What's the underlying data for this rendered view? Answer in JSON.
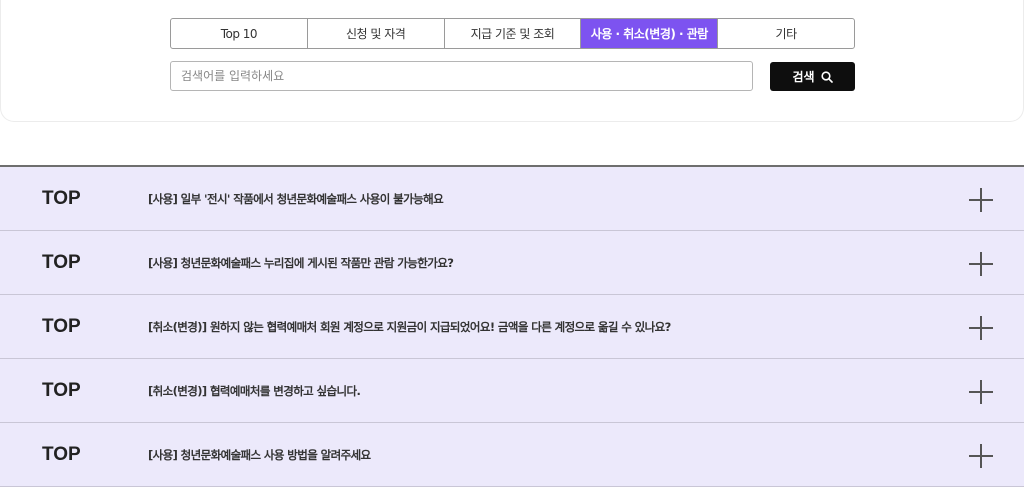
{
  "tabs": [
    {
      "label": "Top 10",
      "active": false
    },
    {
      "label": "신청 및 자격",
      "active": false
    },
    {
      "label": "지급 기준 및 조회",
      "active": false
    },
    {
      "label": "사용 · 취소(변경) · 관람",
      "active": true
    },
    {
      "label": "기타",
      "active": false
    }
  ],
  "search": {
    "placeholder": "검색어를 입력하세요",
    "button_label": "검색",
    "button_icon": "search-icon"
  },
  "faq": [
    {
      "badge": "TOP",
      "question": "[사용] 일부 '전시' 작품에서 청년문화예술패스 사용이 불가능해요"
    },
    {
      "badge": "TOP",
      "question": "[사용] 청년문화예술패스 누리집에 게시된 작품만 관람 가능한가요?"
    },
    {
      "badge": "TOP",
      "question": "[취소(변경)] 원하지 않는 협력예매처 회원 계정으로 지원금이 지급되었어요! 금액을 다른 계정으로 옮길 수 있나요?"
    },
    {
      "badge": "TOP",
      "question": "[취소(변경)] 협력예매처를 변경하고 싶습니다."
    },
    {
      "badge": "TOP",
      "question": "[사용] 청년문화예술패스 사용 방법을 알려주세요"
    }
  ],
  "colors": {
    "accent": "#7d53f0",
    "row_background": "#ece9fb",
    "search_button": "#0e0e0e"
  }
}
